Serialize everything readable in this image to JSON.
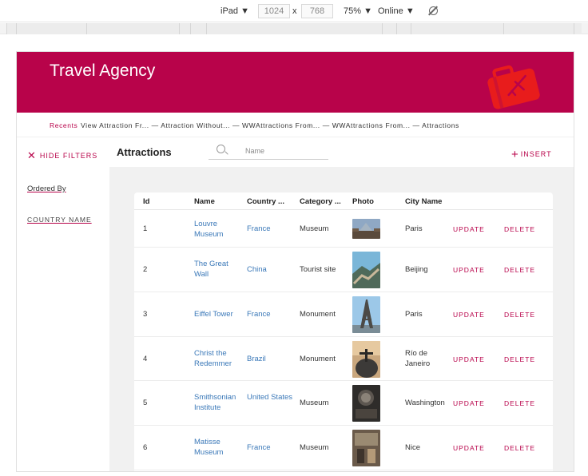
{
  "devtools": {
    "device": "iPad",
    "width": "1024",
    "separator": "x",
    "height": "768",
    "zoom": "75%",
    "network": "Online"
  },
  "app": {
    "title": "Travel Agency",
    "brand_color": "#b8034a",
    "breadcrumb": {
      "recents": "Recents",
      "trail": "View Attraction Fr... — Attraction Without... — WWAttractions From... — WWAttractions From... — Attractions"
    },
    "toolbar": {
      "hide_filters": "HIDE FILTERS",
      "page_title": "Attractions",
      "search_placeholder": "Name",
      "insert": "INSERT"
    },
    "filters": {
      "ordered_by": "Ordered By",
      "country_name": "COUNTRY NAME"
    },
    "grid": {
      "columns": [
        "Id",
        "Name",
        "Country ...",
        "Category ...",
        "Photo",
        "City Name"
      ],
      "action_update": "UPDATE",
      "action_delete": "DELETE",
      "rows": [
        {
          "id": "1",
          "name": "Louvre Museum",
          "country": "France",
          "category": "Museum",
          "photo": "louvre-photo",
          "city": "Paris"
        },
        {
          "id": "2",
          "name": "The Great Wall",
          "country": "China",
          "category": "Tourist site",
          "photo": "great-wall-photo",
          "city": "Beijing"
        },
        {
          "id": "3",
          "name": "Eiffel Tower",
          "country": "France",
          "category": "Monument",
          "photo": "eiffel-tower-photo",
          "city": "Paris"
        },
        {
          "id": "4",
          "name": "Christ the Redemmer",
          "country": "Brazil",
          "category": "Monument",
          "photo": "christ-redeemer-photo",
          "city": "Río de Janeiro"
        },
        {
          "id": "5",
          "name": "Smithsonian Institute",
          "country": "United States",
          "category": "Museum",
          "photo": "smithsonian-photo",
          "city": "Washington"
        },
        {
          "id": "6",
          "name": "Matisse Museum",
          "country": "France",
          "category": "Museum",
          "photo": "matisse-photo",
          "city": "Nice"
        }
      ]
    }
  }
}
